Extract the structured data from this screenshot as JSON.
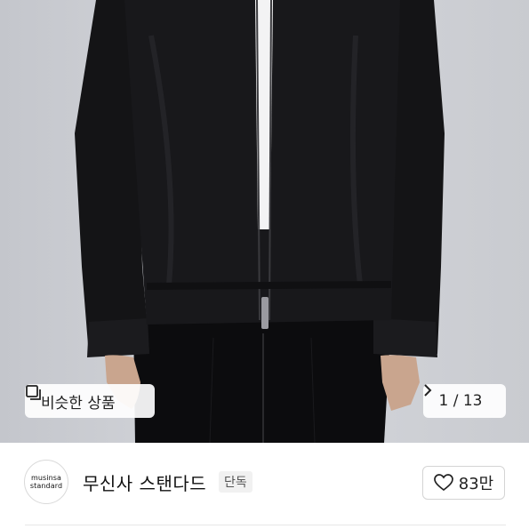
{
  "product_gallery": {
    "similar_products_label": "비슷한 상품",
    "counter": "1 / 13"
  },
  "brand": {
    "logo_line1": "musinsa",
    "logo_line2": "standard",
    "name": "무신사 스탠다드",
    "badge": "단독",
    "likes": "83만"
  },
  "icons": {
    "similar": "similar-products-icon",
    "next": "chevron-right-icon",
    "like": "heart-icon"
  }
}
